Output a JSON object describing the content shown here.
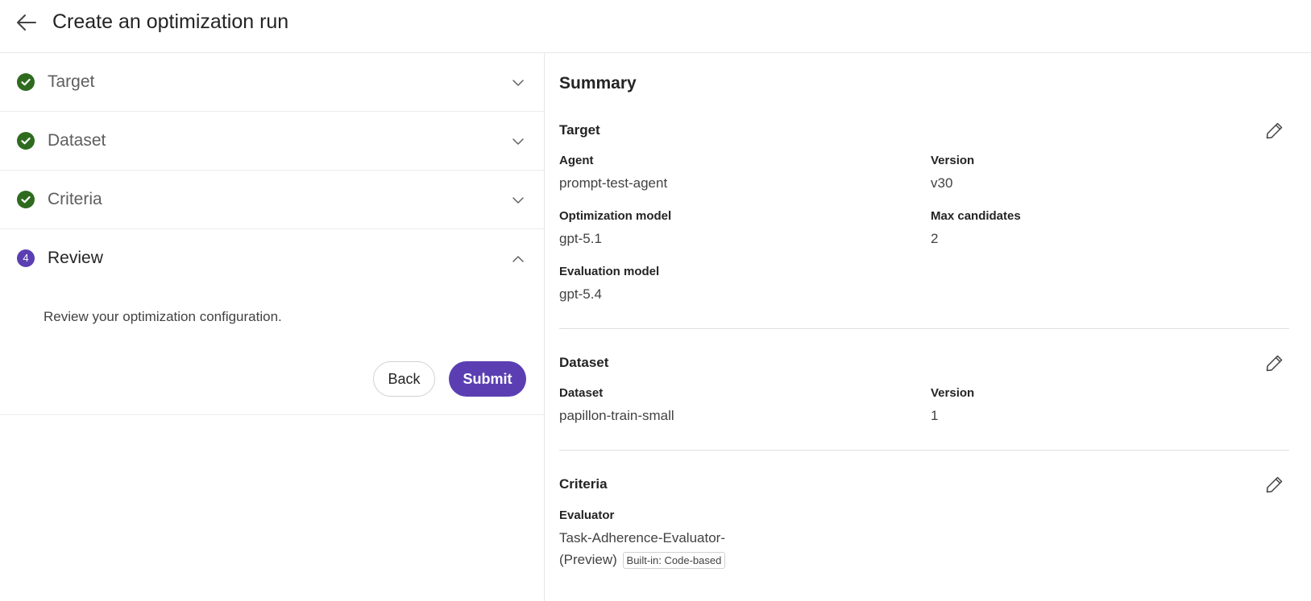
{
  "header": {
    "title": "Create an optimization run",
    "back_icon": "arrow-left-icon"
  },
  "steps": [
    {
      "label": "Target",
      "status": "complete"
    },
    {
      "label": "Dataset",
      "status": "complete"
    },
    {
      "label": "Criteria",
      "status": "complete"
    },
    {
      "label": "Review",
      "number": "4",
      "status": "active"
    }
  ],
  "review": {
    "description": "Review your optimization configuration.",
    "back_label": "Back",
    "submit_label": "Submit"
  },
  "summary": {
    "title": "Summary",
    "target": {
      "title": "Target",
      "agent_label": "Agent",
      "agent_value": "prompt-test-agent",
      "version_label": "Version",
      "version_value": "v30",
      "opt_model_label": "Optimization model",
      "opt_model_value": "gpt-5.1",
      "max_candidates_label": "Max candidates",
      "max_candidates_value": "2",
      "eval_model_label": "Evaluation model",
      "eval_model_value": "gpt-5.4"
    },
    "dataset": {
      "title": "Dataset",
      "dataset_label": "Dataset",
      "dataset_value": "papillon-train-small",
      "version_label": "Version",
      "version_value": "1"
    },
    "criteria": {
      "title": "Criteria",
      "evaluator_label": "Evaluator",
      "evaluator_line1": "Task-Adherence-Evaluator-",
      "evaluator_line2": "(Preview)",
      "evaluator_badge": "Built-in: Code-based"
    }
  },
  "colors": {
    "accent": "#5b3fb2",
    "success": "#2e6b1f"
  }
}
